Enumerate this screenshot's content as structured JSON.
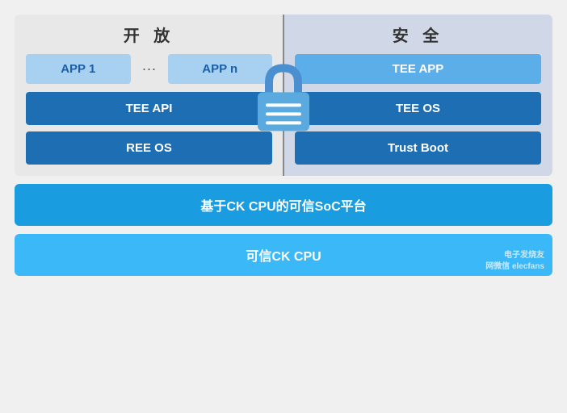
{
  "left": {
    "title": "开 放",
    "app1": "APP 1",
    "dots": "···",
    "appn": "APP n",
    "api_bar": "TEE API",
    "os_bar": "REE OS"
  },
  "right": {
    "title": "安 全",
    "tee_app": "TEE APP",
    "tee_os": "TEE OS",
    "trust_boot": "Trust Boot"
  },
  "bottom": {
    "soc_bar": "基于CK CPU的可信SoC平台",
    "cpu_bar": "可信CK CPU",
    "watermark_line1": "电子发烧友",
    "watermark_line2": "网微信 elecfans"
  }
}
